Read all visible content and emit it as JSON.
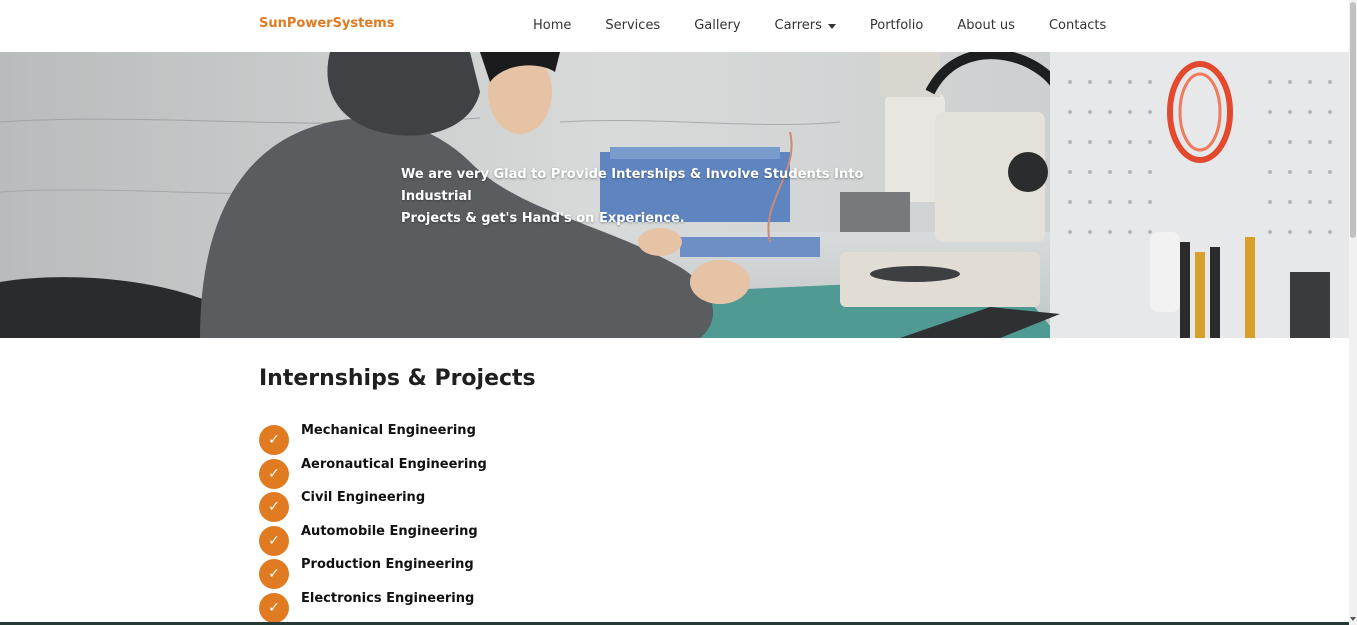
{
  "brand": {
    "name": "SunPowerSystems",
    "color": "#e07b22"
  },
  "nav": {
    "items": [
      {
        "label": "Home"
      },
      {
        "label": "Services"
      },
      {
        "label": "Gallery"
      },
      {
        "label": "Carrers",
        "has_dropdown": true,
        "icon": "chevron-down-icon"
      },
      {
        "label": "Portfolio"
      },
      {
        "label": "About us"
      },
      {
        "label": "Contacts"
      }
    ]
  },
  "hero": {
    "line1": "We are very Glad to Provide Interships & Involve Students Into Industrial",
    "line2": "Projects & get's Hand's on Experience."
  },
  "section": {
    "title": "Internships & Projects",
    "check_icon": "check-icon",
    "items": [
      {
        "label": "Mechanical Engineering"
      },
      {
        "label": "Aeronautical Engineering"
      },
      {
        "label": "Civil Engineering"
      },
      {
        "label": "Automobile Engineering"
      },
      {
        "label": "Production Engineering"
      },
      {
        "label": "Electronics Engineering"
      }
    ]
  }
}
